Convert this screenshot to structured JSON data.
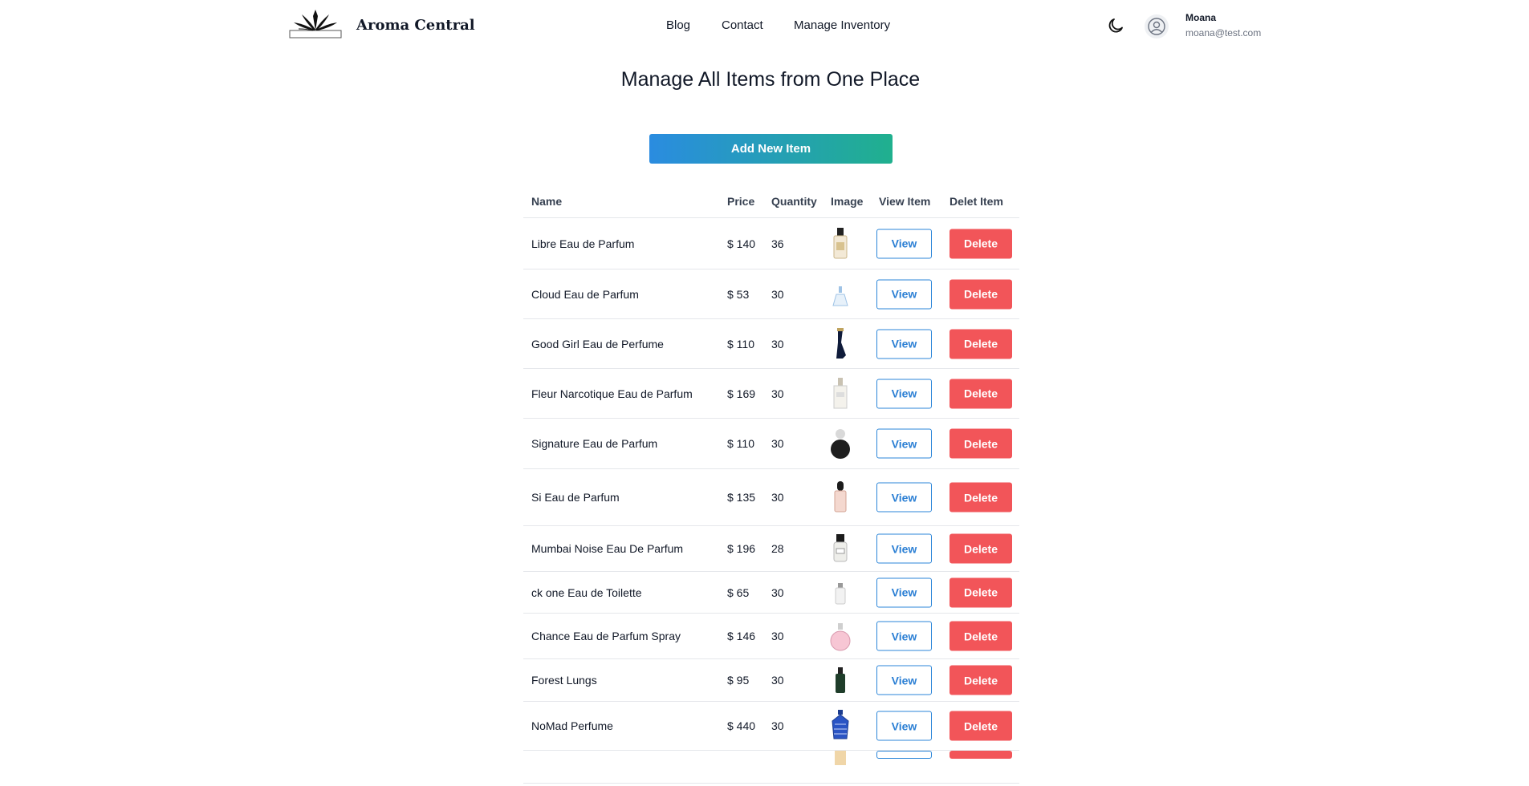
{
  "header": {
    "brand": "Aroma Central",
    "nav": [
      "Blog",
      "Contact",
      "Manage Inventory"
    ],
    "user": {
      "name": "Moana",
      "email": "moana@test.com"
    }
  },
  "main": {
    "title": "Manage All Items from One Place",
    "add_button": "Add New Item",
    "columns": [
      "Name",
      "Price",
      "Quantity",
      "Image",
      "View Item",
      "Delet Item"
    ],
    "view_label": "View",
    "delete_label": "Delete",
    "rows": [
      {
        "name": "Libre Eau de Parfum",
        "price": "$ 140",
        "quantity": "36",
        "bottle": "libre",
        "h": 63
      },
      {
        "name": "Cloud Eau de Parfum",
        "price": "$ 53",
        "quantity": "30",
        "bottle": "cloud",
        "h": 61
      },
      {
        "name": "Good Girl Eau de Perfume",
        "price": "$ 110",
        "quantity": "30",
        "bottle": "heel",
        "h": 61
      },
      {
        "name": "Fleur Narcotique Eau de Parfum",
        "price": "$ 169",
        "quantity": "30",
        "bottle": "square",
        "h": 61
      },
      {
        "name": "Signature Eau de Parfum",
        "price": "$ 110",
        "quantity": "30",
        "bottle": "round-black",
        "h": 62
      },
      {
        "name": "Si Eau de Parfum",
        "price": "$ 135",
        "quantity": "30",
        "bottle": "pink",
        "h": 70
      },
      {
        "name": "Mumbai Noise Eau De Parfum",
        "price": "$ 196",
        "quantity": "28",
        "bottle": "byredo",
        "h": 56
      },
      {
        "name": "ck one Eau de Toilette",
        "price": "$ 65",
        "quantity": "30",
        "bottle": "ck",
        "h": 51
      },
      {
        "name": "Chance Eau de Parfum Spray",
        "price": "$ 146",
        "quantity": "30",
        "bottle": "chance",
        "h": 56
      },
      {
        "name": "Forest Lungs",
        "price": "$ 95",
        "quantity": "30",
        "bottle": "green",
        "h": 52
      },
      {
        "name": "NoMad Perfume",
        "price": "$ 440",
        "quantity": "30",
        "bottle": "nomad",
        "h": 60
      },
      {
        "name": "",
        "price": "",
        "quantity": "",
        "bottle": "partial",
        "h": 40
      }
    ]
  },
  "colors": {
    "accent_blue": "#2b85d8",
    "accent_green": "#20b08e",
    "danger": "#f25559"
  }
}
